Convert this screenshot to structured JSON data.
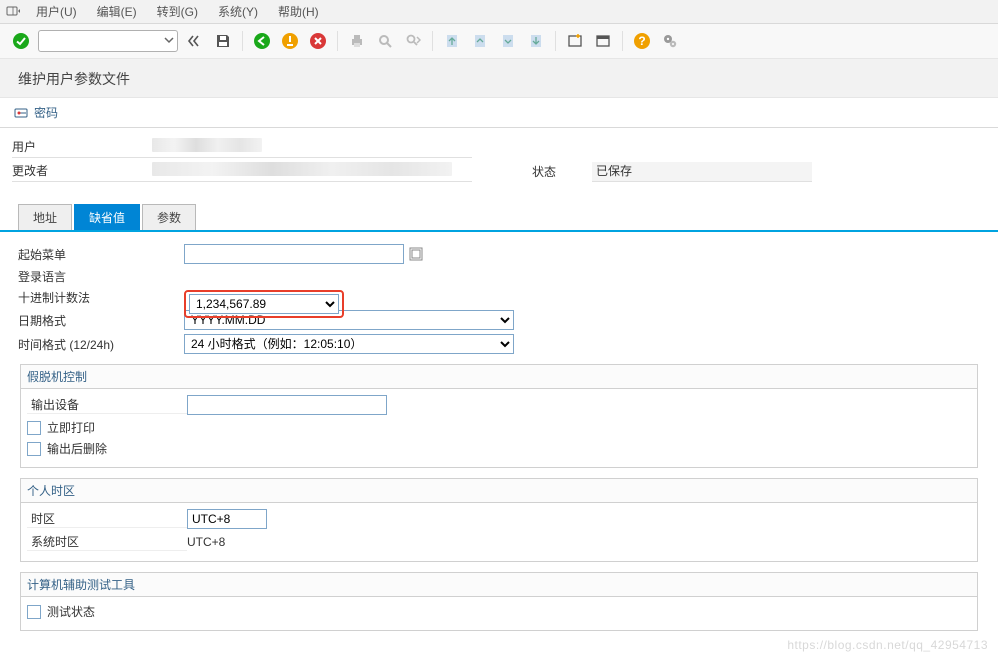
{
  "menu": {
    "user": "用户(U)",
    "edit": "编辑(E)",
    "goto": "转到(G)",
    "system": "系统(Y)",
    "help": "帮助(H)"
  },
  "page_title": "维护用户参数文件",
  "password_btn": "密码",
  "header": {
    "user_lbl": "用户",
    "changer_lbl": "更改者",
    "status_lbl": "状态",
    "status_val": "已保存"
  },
  "tabs": {
    "address": "地址",
    "defaults": "缺省值",
    "params": "参数"
  },
  "defaults": {
    "start_menu_lbl": "起始菜单",
    "logon_lang_lbl": "登录语言",
    "decimal_lbl": "十进制计数法",
    "decimal_val": "1,234,567.89",
    "date_lbl": "日期格式",
    "date_val": "YYYY.MM.DD",
    "time_lbl": "时间格式 (12/24h)",
    "time_val": "24 小时格式（例如：12:05:10）"
  },
  "spool": {
    "title": "假脱机控制",
    "device_lbl": "输出设备",
    "print_now": "立即打印",
    "delete_after": "输出后删除"
  },
  "tz": {
    "title": "个人时区",
    "tz_lbl": "时区",
    "tz_val": "UTC+8",
    "sys_tz_lbl": "系统时区",
    "sys_tz_val": "UTC+8"
  },
  "catt": {
    "title": "计算机辅助测试工具",
    "status": "测试状态"
  },
  "watermark": "https://blog.csdn.net/qq_42954713"
}
